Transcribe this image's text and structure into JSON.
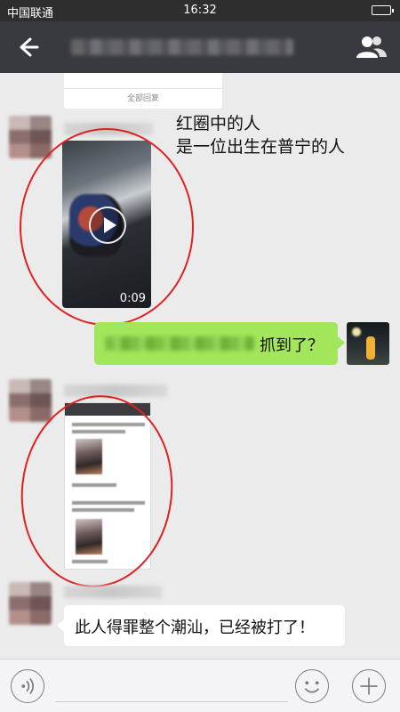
{
  "status_bar": {
    "carrier": "中国联通",
    "time": "16:32"
  },
  "nav": {
    "back_icon": "back-arrow-icon",
    "group_icon": "group-members-icon"
  },
  "messages": {
    "card_footer": "全部回复",
    "video_duration": "0:09",
    "annotation_line1": "红圈中的人",
    "annotation_line2": "是一位出生在普宁的人",
    "outgoing_text": "抓到了？",
    "final_text": "此人得罪整个潮汕，已经被打了！"
  },
  "input_bar": {
    "voice_icon": "voice-icon",
    "emoji_icon": "emoji-icon",
    "plus_icon": "plus-icon"
  },
  "colors": {
    "nav_bg": "#393a3f",
    "chat_bg": "#ebebeb",
    "outgoing_bubble": "#a2e65b",
    "annotation_circle": "#e02020"
  }
}
